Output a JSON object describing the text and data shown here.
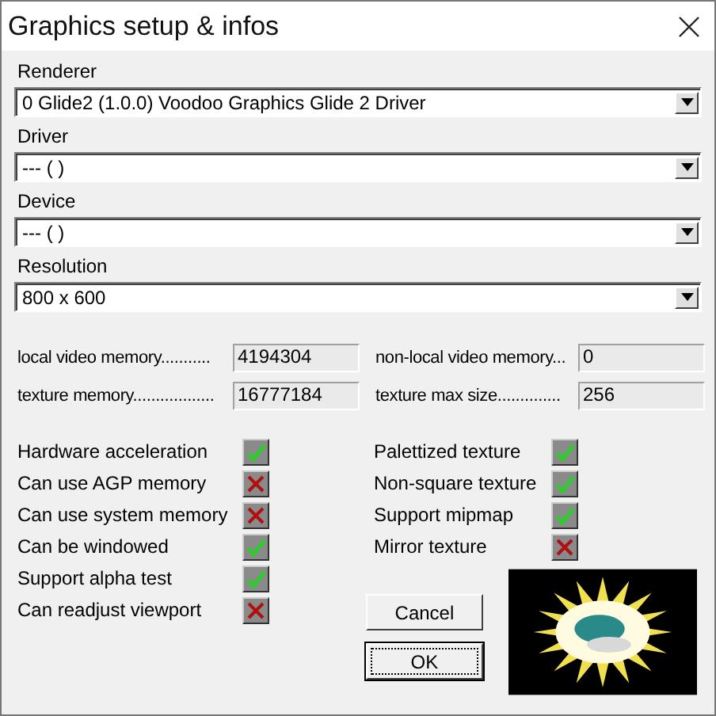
{
  "window": {
    "title": "Graphics setup & infos"
  },
  "dropdowns": [
    {
      "label": "Renderer",
      "value": "0 Glide2 (1.0.0) Voodoo Graphics Glide 2 Driver"
    },
    {
      "label": "Driver",
      "value": "--- (  )"
    },
    {
      "label": "Device",
      "value": "--- (  )"
    },
    {
      "label": "Resolution",
      "value": "800 x 600"
    }
  ],
  "memory": [
    {
      "label": "local video memory...........",
      "value": "4194304"
    },
    {
      "label": "non-local video memory...",
      "value": "0"
    },
    {
      "label": "texture memory..................",
      "value": "16777184"
    },
    {
      "label": "texture max size..............",
      "value": "256"
    }
  ],
  "capabilities_left": [
    {
      "label": "Hardware acceleration",
      "supported": true
    },
    {
      "label": "Can use AGP memory",
      "supported": false
    },
    {
      "label": "Can use system memory",
      "supported": false
    },
    {
      "label": "Can be windowed",
      "supported": true
    },
    {
      "label": "Support alpha test",
      "supported": true
    },
    {
      "label": "Can readjust viewport",
      "supported": false
    }
  ],
  "capabilities_right": [
    {
      "label": "Palettized texture",
      "supported": true
    },
    {
      "label": "Non-square texture",
      "supported": true
    },
    {
      "label": "Support mipmap",
      "supported": true
    },
    {
      "label": "Mirror texture",
      "supported": false
    }
  ],
  "buttons": [
    {
      "label": "Cancel",
      "focused": false
    },
    {
      "label": "OK",
      "focused": true
    }
  ]
}
